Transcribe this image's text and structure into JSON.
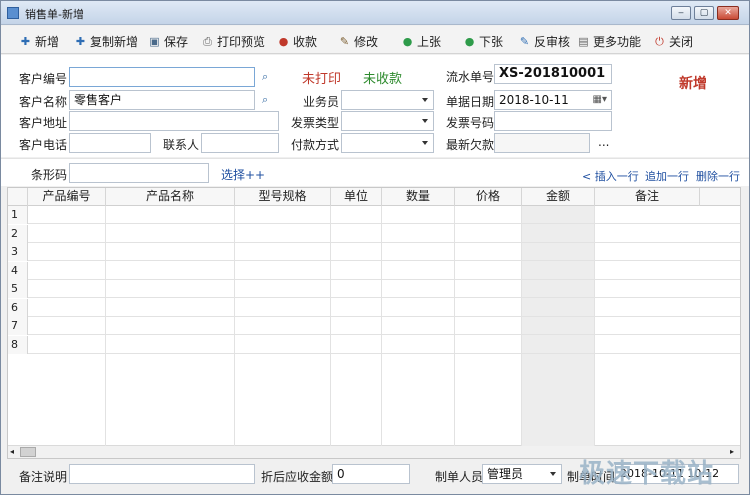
{
  "window": {
    "title": "销售单-新增",
    "min": "‒",
    "max": "▢",
    "close": "✕"
  },
  "toolbar": [
    {
      "label": "新增",
      "icon": "add-icon",
      "glyph": "✚",
      "color": "#2e6db4"
    },
    {
      "label": "复制新增",
      "icon": "copy-add-icon",
      "glyph": "✚",
      "color": "#2e6db4"
    },
    {
      "label": "保存",
      "icon": "save-icon",
      "glyph": "▣",
      "color": "#4a6a8a"
    },
    {
      "label": "打印预览",
      "icon": "print-icon",
      "glyph": "⎙",
      "color": "#666"
    },
    {
      "label": "收款",
      "icon": "receive-icon",
      "glyph": "●",
      "color": "#c0392b"
    },
    {
      "label": "修改",
      "icon": "edit-icon",
      "glyph": "✎",
      "color": "#7a5c2e"
    },
    {
      "label": "上张",
      "icon": "prev-icon",
      "glyph": "●",
      "color": "#2e9b4a"
    },
    {
      "label": "下张",
      "icon": "next-icon",
      "glyph": "●",
      "color": "#2e9b4a"
    },
    {
      "label": "反审核",
      "icon": "unaudit-icon",
      "glyph": "✎",
      "color": "#2e6db4"
    },
    {
      "label": "更多功能",
      "icon": "more-icon",
      "glyph": "▤",
      "color": "#666"
    },
    {
      "label": "关闭",
      "icon": "close-doc-icon",
      "glyph": "⏻",
      "color": "#c0392b"
    }
  ],
  "form": {
    "customer_no_label": "客户编号",
    "customer_no": "",
    "customer_name_label": "客户名称",
    "customer_name": "零售客户",
    "address_label": "客户地址",
    "address": "",
    "phone_label": "客户电话",
    "phone": "",
    "contact_label": "联系人",
    "contact": "",
    "print_status": "未打印",
    "pay_status": "未收款",
    "salesman_label": "业务员",
    "salesman": "",
    "invoice_type_label": "发票类型",
    "invoice_type": "",
    "pay_method_label": "付款方式",
    "pay_method": "",
    "serial_label": "流水单号",
    "serial": "XS-201810001",
    "date_label": "单据日期",
    "date": "2018-10-11",
    "invoice_no_label": "发票号码",
    "invoice_no": "",
    "latest_debt_label": "最新欠款",
    "latest_debt": "",
    "ellipsis": "...",
    "mode": "新增"
  },
  "barcode": {
    "label": "条形码",
    "value": "",
    "select": "选择++",
    "insert": "< 插入一行",
    "append": "追加一行",
    "delete": "删除一行"
  },
  "grid": {
    "columns": [
      "产品编号",
      "产品名称",
      "型号规格",
      "单位",
      "数量",
      "价格",
      "金额",
      "备注"
    ],
    "rows": [
      "1",
      "2",
      "3",
      "4",
      "5",
      "6",
      "7",
      "8"
    ]
  },
  "footer": {
    "note_label": "备注说明",
    "note": "",
    "discount_label": "折后应收金额",
    "discount": "0",
    "maker_label": "制单人员",
    "maker": "管理员",
    "made_time_label": "制单时间",
    "made_time": "2018-10-11 10:12"
  },
  "watermark": "极速下载站"
}
